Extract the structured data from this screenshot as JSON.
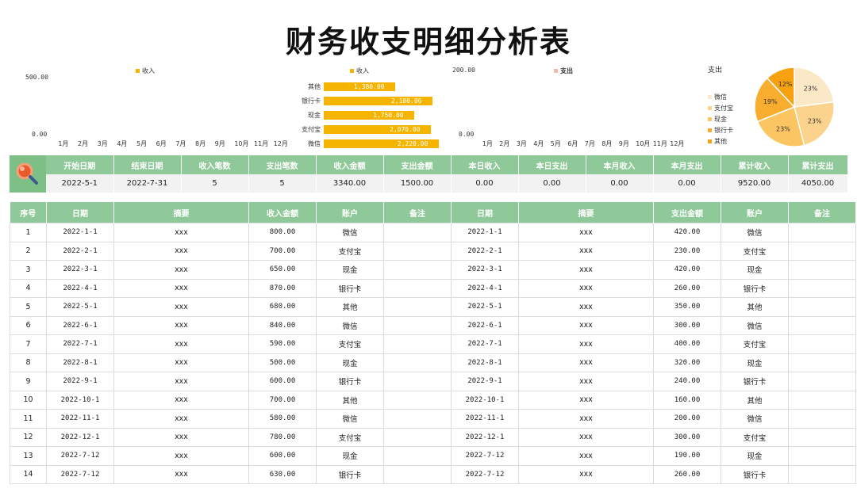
{
  "title": "财务收支明细分析表",
  "charts": {
    "income_monthly": {
      "legend": "收入",
      "y_top_label": "500.00",
      "y_bottom_label": "0.00",
      "months": [
        "1月",
        "2月",
        "3月",
        "4月",
        "5月",
        "6月",
        "7月",
        "8月",
        "9月",
        "10月",
        "11月",
        "12月"
      ],
      "color": "#f4b400"
    },
    "income_by_account": {
      "legend": "收入",
      "color": "#f4b400",
      "bars": [
        {
          "label": "其他",
          "value": 1380,
          "text": "1,380.00"
        },
        {
          "label": "银行卡",
          "value": 2100,
          "text": "2,100.00"
        },
        {
          "label": "现金",
          "value": 1750,
          "text": "1,750.00"
        },
        {
          "label": "支付宝",
          "value": 2070,
          "text": "2,070.00"
        },
        {
          "label": "微信",
          "value": 2220,
          "text": "2,220.00"
        }
      ]
    },
    "expense_monthly": {
      "legend": "支出",
      "y_top_label": "200.00",
      "y_bottom_label": "0.00",
      "months": [
        "1月",
        "2月",
        "3月",
        "4月",
        "5月",
        "6月",
        "7月",
        "8月",
        "9月",
        "10月",
        "11月",
        "12月"
      ],
      "color": "#f4b9a8"
    },
    "expense_pie": {
      "title": "支出",
      "slices": [
        {
          "label": "微信",
          "percent": 23,
          "text": "23%",
          "color": "#fbe8c6"
        },
        {
          "label": "支付宝",
          "percent": 23,
          "text": "23%",
          "color": "#fcd38d"
        },
        {
          "label": "现金",
          "percent": 23,
          "text": "23%",
          "color": "#fbc561"
        },
        {
          "label": "银行卡",
          "percent": 19,
          "text": "19%",
          "color": "#f8ad2f"
        },
        {
          "label": "其他",
          "percent": 12,
          "text": "12%",
          "color": "#f6a10f"
        }
      ]
    }
  },
  "summary": {
    "headers": [
      "开始日期",
      "结束日期",
      "收入笔数",
      "支出笔数",
      "收入金额",
      "支出金额",
      "本日收入",
      "本日支出",
      "本月收入",
      "本月支出",
      "累计收入",
      "累计支出"
    ],
    "values": [
      "2022-5-1",
      "2022-7-31",
      "5",
      "5",
      "3340.00",
      "1500.00",
      "0.00",
      "0.00",
      "0.00",
      "0.00",
      "9520.00",
      "4050.00"
    ]
  },
  "details": {
    "headers": [
      "序号",
      "日期",
      "摘要",
      "收入金额",
      "账户",
      "备注",
      "日期",
      "摘要",
      "支出金额",
      "账户",
      "备注"
    ],
    "rows": [
      [
        "1",
        "2022-1-1",
        "xxx",
        "800.00",
        "微信",
        "",
        "2022-1-1",
        "xxx",
        "420.00",
        "微信",
        ""
      ],
      [
        "2",
        "2022-2-1",
        "xxx",
        "700.00",
        "支付宝",
        "",
        "2022-2-1",
        "xxx",
        "230.00",
        "支付宝",
        ""
      ],
      [
        "3",
        "2022-3-1",
        "xxx",
        "650.00",
        "现金",
        "",
        "2022-3-1",
        "xxx",
        "420.00",
        "现金",
        ""
      ],
      [
        "4",
        "2022-4-1",
        "xxx",
        "870.00",
        "银行卡",
        "",
        "2022-4-1",
        "xxx",
        "260.00",
        "银行卡",
        ""
      ],
      [
        "5",
        "2022-5-1",
        "xxx",
        "680.00",
        "其他",
        "",
        "2022-5-1",
        "xxx",
        "350.00",
        "其他",
        ""
      ],
      [
        "6",
        "2022-6-1",
        "xxx",
        "840.00",
        "微信",
        "",
        "2022-6-1",
        "xxx",
        "300.00",
        "微信",
        ""
      ],
      [
        "7",
        "2022-7-1",
        "xxx",
        "590.00",
        "支付宝",
        "",
        "2022-7-1",
        "xxx",
        "400.00",
        "支付宝",
        ""
      ],
      [
        "8",
        "2022-8-1",
        "xxx",
        "500.00",
        "现金",
        "",
        "2022-8-1",
        "xxx",
        "320.00",
        "现金",
        ""
      ],
      [
        "9",
        "2022-9-1",
        "xxx",
        "600.00",
        "银行卡",
        "",
        "2022-9-1",
        "xxx",
        "240.00",
        "银行卡",
        ""
      ],
      [
        "10",
        "2022-10-1",
        "xxx",
        "700.00",
        "其他",
        "",
        "2022-10-1",
        "xxx",
        "160.00",
        "其他",
        ""
      ],
      [
        "11",
        "2022-11-1",
        "xxx",
        "580.00",
        "微信",
        "",
        "2022-11-1",
        "xxx",
        "200.00",
        "微信",
        ""
      ],
      [
        "12",
        "2022-12-1",
        "xxx",
        "780.00",
        "支付宝",
        "",
        "2022-12-1",
        "xxx",
        "300.00",
        "支付宝",
        ""
      ],
      [
        "13",
        "2022-7-12",
        "xxx",
        "600.00",
        "现金",
        "",
        "2022-7-12",
        "xxx",
        "190.00",
        "现金",
        ""
      ],
      [
        "14",
        "2022-7-12",
        "xxx",
        "630.00",
        "银行卡",
        "",
        "2022-7-12",
        "xxx",
        "260.00",
        "银行卡",
        ""
      ]
    ]
  }
}
